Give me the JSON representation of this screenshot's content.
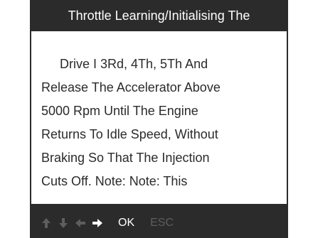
{
  "screen": {
    "title": "Throttle Learning/Initialising The",
    "body_lines": [
      "Drive I 3Rd, 4Th, 5Th And",
      "Release The Accelerator Above",
      "5000 Rpm Until The Engine",
      "Returns To Idle Speed, Without",
      "Braking So That The Injection",
      "Cuts Off. Note: Note: This"
    ]
  },
  "footer": {
    "icons": [
      "arrow-up-icon",
      "arrow-down-icon",
      "arrow-left-icon",
      "arrow-right-icon"
    ],
    "ok_label": "OK",
    "esc_label": "ESC"
  },
  "colors": {
    "frame": "#2b2b2b",
    "content_bg": "#ffffff",
    "active_icon": "#ffffff",
    "disabled": "#5e5e5e"
  }
}
